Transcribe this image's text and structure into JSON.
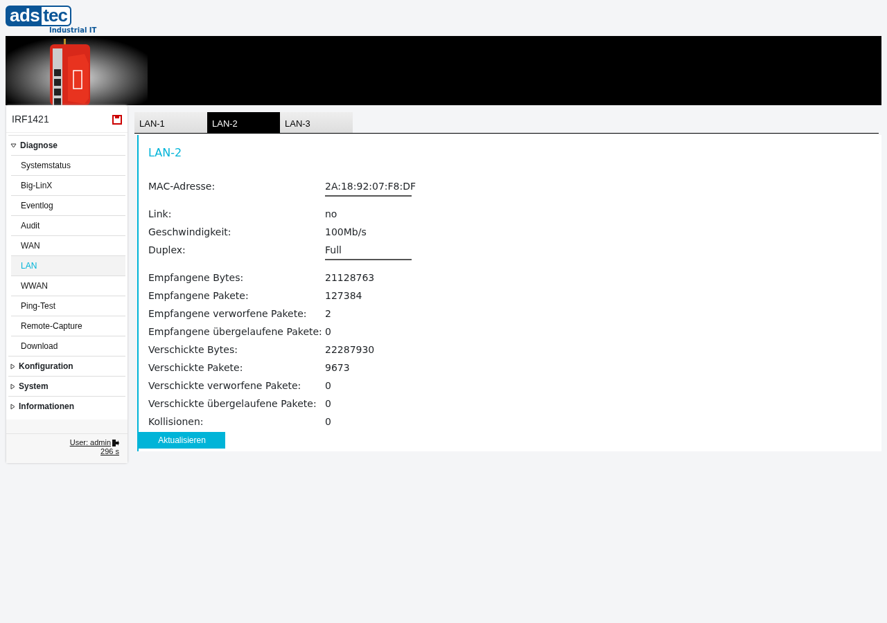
{
  "logo": {
    "left": "ads",
    "right": "tec",
    "tagline": "Industrial IT"
  },
  "sidebar": {
    "device": "IRF1421",
    "sections": [
      {
        "label": "Diagnose",
        "expanded": true,
        "children": [
          {
            "label": "Systemstatus",
            "selected": false
          },
          {
            "label": "Big-LinX",
            "selected": false
          },
          {
            "label": "Eventlog",
            "selected": false
          },
          {
            "label": "Audit",
            "selected": false
          },
          {
            "label": "WAN",
            "selected": false
          },
          {
            "label": "LAN",
            "selected": true
          },
          {
            "label": "WWAN",
            "selected": false
          },
          {
            "label": "Ping-Test",
            "selected": false
          },
          {
            "label": "Remote-Capture",
            "selected": false
          },
          {
            "label": "Download",
            "selected": false
          }
        ]
      },
      {
        "label": "Konfiguration",
        "expanded": false
      },
      {
        "label": "System",
        "expanded": false
      },
      {
        "label": "Informationen",
        "expanded": false
      }
    ],
    "user": "User: admin",
    "timer": "296 s"
  },
  "tabs": [
    {
      "label": "LAN-1",
      "selected": false
    },
    {
      "label": "LAN-2",
      "selected": true
    },
    {
      "label": "LAN-3",
      "selected": false
    }
  ],
  "panel": {
    "title": "LAN-2",
    "rows": [
      {
        "kind": "field",
        "label": "MAC-Adresse:",
        "value": "2A:18:92:07:F8:DF"
      },
      {
        "kind": "divider"
      },
      {
        "kind": "field",
        "label": "Link:",
        "value": "no"
      },
      {
        "kind": "field",
        "label": "Geschwindigkeit:",
        "value": "100Mb/s"
      },
      {
        "kind": "field",
        "label": "Duplex:",
        "value": "Full"
      },
      {
        "kind": "divider"
      },
      {
        "kind": "field",
        "label": "Empfangene Bytes:",
        "value": "21128763"
      },
      {
        "kind": "field",
        "label": "Empfangene Pakete:",
        "value": "127384"
      },
      {
        "kind": "field",
        "label": "Empfangene verworfene Pakete:",
        "value": "2"
      },
      {
        "kind": "field",
        "label": "Empfangene übergelaufene Pakete:",
        "value": "0"
      },
      {
        "kind": "field",
        "label": "Verschickte Bytes:",
        "value": "22287930"
      },
      {
        "kind": "field",
        "label": "Verschickte Pakete:",
        "value": "9673"
      },
      {
        "kind": "field",
        "label": "Verschickte verworfene Pakete:",
        "value": "0"
      },
      {
        "kind": "field",
        "label": "Verschickte übergelaufene Pakete:",
        "value": "0"
      },
      {
        "kind": "field",
        "label": "Kollisionen:",
        "value": "0"
      }
    ],
    "button": "Aktualisieren"
  }
}
